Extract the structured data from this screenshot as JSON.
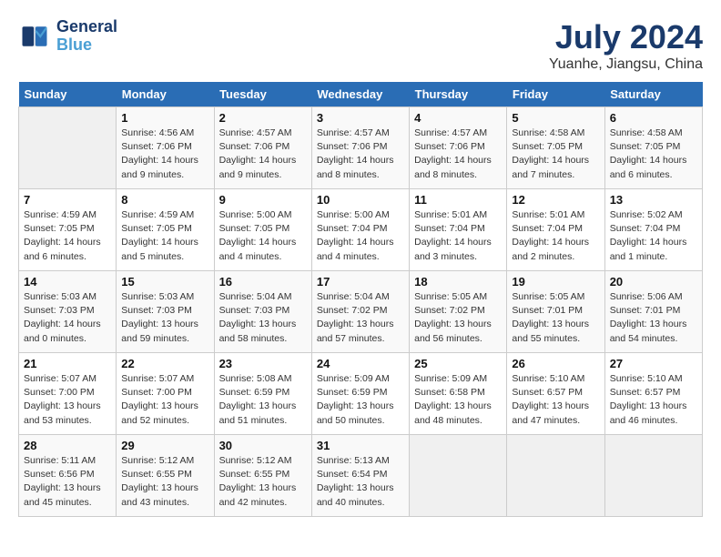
{
  "header": {
    "logo_line1": "General",
    "logo_line2": "Blue",
    "month": "July 2024",
    "location": "Yuanhe, Jiangsu, China"
  },
  "days_of_week": [
    "Sunday",
    "Monday",
    "Tuesday",
    "Wednesday",
    "Thursday",
    "Friday",
    "Saturday"
  ],
  "weeks": [
    [
      {
        "num": "",
        "info": ""
      },
      {
        "num": "1",
        "info": "Sunrise: 4:56 AM\nSunset: 7:06 PM\nDaylight: 14 hours\nand 9 minutes."
      },
      {
        "num": "2",
        "info": "Sunrise: 4:57 AM\nSunset: 7:06 PM\nDaylight: 14 hours\nand 9 minutes."
      },
      {
        "num": "3",
        "info": "Sunrise: 4:57 AM\nSunset: 7:06 PM\nDaylight: 14 hours\nand 8 minutes."
      },
      {
        "num": "4",
        "info": "Sunrise: 4:57 AM\nSunset: 7:06 PM\nDaylight: 14 hours\nand 8 minutes."
      },
      {
        "num": "5",
        "info": "Sunrise: 4:58 AM\nSunset: 7:05 PM\nDaylight: 14 hours\nand 7 minutes."
      },
      {
        "num": "6",
        "info": "Sunrise: 4:58 AM\nSunset: 7:05 PM\nDaylight: 14 hours\nand 6 minutes."
      }
    ],
    [
      {
        "num": "7",
        "info": "Sunrise: 4:59 AM\nSunset: 7:05 PM\nDaylight: 14 hours\nand 6 minutes."
      },
      {
        "num": "8",
        "info": "Sunrise: 4:59 AM\nSunset: 7:05 PM\nDaylight: 14 hours\nand 5 minutes."
      },
      {
        "num": "9",
        "info": "Sunrise: 5:00 AM\nSunset: 7:05 PM\nDaylight: 14 hours\nand 4 minutes."
      },
      {
        "num": "10",
        "info": "Sunrise: 5:00 AM\nSunset: 7:04 PM\nDaylight: 14 hours\nand 4 minutes."
      },
      {
        "num": "11",
        "info": "Sunrise: 5:01 AM\nSunset: 7:04 PM\nDaylight: 14 hours\nand 3 minutes."
      },
      {
        "num": "12",
        "info": "Sunrise: 5:01 AM\nSunset: 7:04 PM\nDaylight: 14 hours\nand 2 minutes."
      },
      {
        "num": "13",
        "info": "Sunrise: 5:02 AM\nSunset: 7:04 PM\nDaylight: 14 hours\nand 1 minute."
      }
    ],
    [
      {
        "num": "14",
        "info": "Sunrise: 5:03 AM\nSunset: 7:03 PM\nDaylight: 14 hours\nand 0 minutes."
      },
      {
        "num": "15",
        "info": "Sunrise: 5:03 AM\nSunset: 7:03 PM\nDaylight: 13 hours\nand 59 minutes."
      },
      {
        "num": "16",
        "info": "Sunrise: 5:04 AM\nSunset: 7:03 PM\nDaylight: 13 hours\nand 58 minutes."
      },
      {
        "num": "17",
        "info": "Sunrise: 5:04 AM\nSunset: 7:02 PM\nDaylight: 13 hours\nand 57 minutes."
      },
      {
        "num": "18",
        "info": "Sunrise: 5:05 AM\nSunset: 7:02 PM\nDaylight: 13 hours\nand 56 minutes."
      },
      {
        "num": "19",
        "info": "Sunrise: 5:05 AM\nSunset: 7:01 PM\nDaylight: 13 hours\nand 55 minutes."
      },
      {
        "num": "20",
        "info": "Sunrise: 5:06 AM\nSunset: 7:01 PM\nDaylight: 13 hours\nand 54 minutes."
      }
    ],
    [
      {
        "num": "21",
        "info": "Sunrise: 5:07 AM\nSunset: 7:00 PM\nDaylight: 13 hours\nand 53 minutes."
      },
      {
        "num": "22",
        "info": "Sunrise: 5:07 AM\nSunset: 7:00 PM\nDaylight: 13 hours\nand 52 minutes."
      },
      {
        "num": "23",
        "info": "Sunrise: 5:08 AM\nSunset: 6:59 PM\nDaylight: 13 hours\nand 51 minutes."
      },
      {
        "num": "24",
        "info": "Sunrise: 5:09 AM\nSunset: 6:59 PM\nDaylight: 13 hours\nand 50 minutes."
      },
      {
        "num": "25",
        "info": "Sunrise: 5:09 AM\nSunset: 6:58 PM\nDaylight: 13 hours\nand 48 minutes."
      },
      {
        "num": "26",
        "info": "Sunrise: 5:10 AM\nSunset: 6:57 PM\nDaylight: 13 hours\nand 47 minutes."
      },
      {
        "num": "27",
        "info": "Sunrise: 5:10 AM\nSunset: 6:57 PM\nDaylight: 13 hours\nand 46 minutes."
      }
    ],
    [
      {
        "num": "28",
        "info": "Sunrise: 5:11 AM\nSunset: 6:56 PM\nDaylight: 13 hours\nand 45 minutes."
      },
      {
        "num": "29",
        "info": "Sunrise: 5:12 AM\nSunset: 6:55 PM\nDaylight: 13 hours\nand 43 minutes."
      },
      {
        "num": "30",
        "info": "Sunrise: 5:12 AM\nSunset: 6:55 PM\nDaylight: 13 hours\nand 42 minutes."
      },
      {
        "num": "31",
        "info": "Sunrise: 5:13 AM\nSunset: 6:54 PM\nDaylight: 13 hours\nand 40 minutes."
      },
      {
        "num": "",
        "info": ""
      },
      {
        "num": "",
        "info": ""
      },
      {
        "num": "",
        "info": ""
      }
    ]
  ]
}
